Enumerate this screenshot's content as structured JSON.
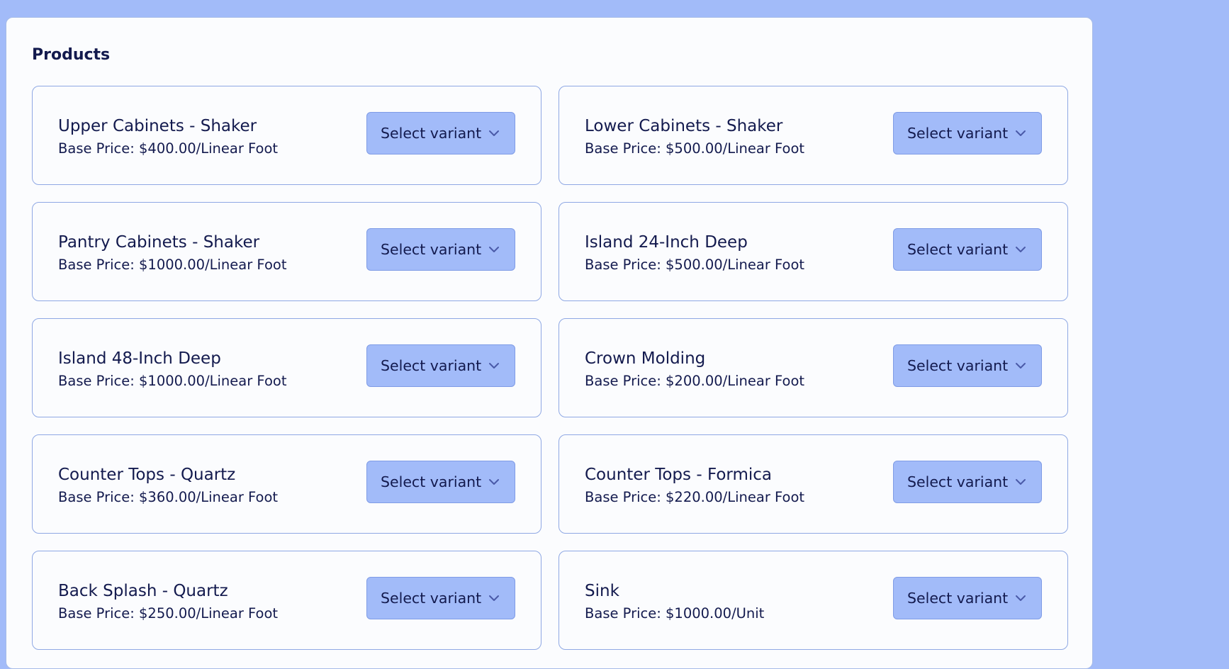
{
  "panel": {
    "title": "Products"
  },
  "select_label": "Select variant",
  "products": [
    {
      "name": "Upper Cabinets - Shaker",
      "price": "Base Price: $400.00/Linear Foot",
      "variant": "Select variant"
    },
    {
      "name": "Lower Cabinets - Shaker",
      "price": "Base Price: $500.00/Linear Foot",
      "variant": "Select variant"
    },
    {
      "name": "Pantry Cabinets - Shaker",
      "price": "Base Price: $1000.00/Linear Foot",
      "variant": "Select variant"
    },
    {
      "name": "Island 24-Inch Deep",
      "price": "Base Price: $500.00/Linear Foot",
      "variant": "Select variant"
    },
    {
      "name": "Island 48-Inch Deep",
      "price": "Base Price: $1000.00/Linear Foot",
      "variant": "Select variant"
    },
    {
      "name": "Crown Molding",
      "price": "Base Price: $200.00/Linear Foot",
      "variant": "Select variant"
    },
    {
      "name": "Counter Tops - Quartz",
      "price": "Base Price: $360.00/Linear Foot",
      "variant": "Select variant"
    },
    {
      "name": "Counter Tops - Formica",
      "price": "Base Price: $220.00/Linear Foot",
      "variant": "Select variant"
    },
    {
      "name": "Back Splash - Quartz",
      "price": "Base Price: $250.00/Linear Foot",
      "variant": "Select variant"
    },
    {
      "name": "Sink",
      "price": "Base Price: $1000.00/Unit",
      "variant": "Select variant"
    }
  ],
  "colors": {
    "background": "#a2bbf9",
    "panel": "#fbfcfe",
    "text": "#131a4e",
    "card_border": "#8fa8e4",
    "select_fill": "#a2bbf9"
  },
  "icons": {
    "select_chevron": "chevron-down-icon"
  }
}
